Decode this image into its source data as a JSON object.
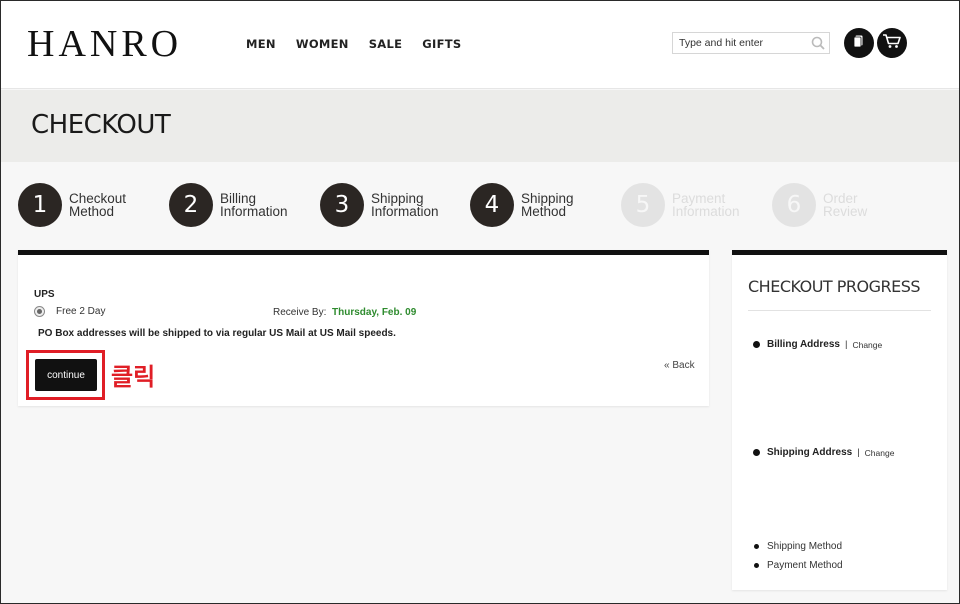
{
  "header": {
    "logo": "HANRO",
    "nav": [
      "MEN",
      "WOMEN",
      "SALE",
      "GIFTS"
    ],
    "search_placeholder": "Type and hit enter",
    "icons": [
      "search-icon",
      "wishlist-icon",
      "cart-icon"
    ]
  },
  "banner": {
    "title": "CHECKOUT"
  },
  "steps": [
    {
      "number": "1",
      "line1": "Checkout",
      "line2": "Method",
      "state": "done"
    },
    {
      "number": "2",
      "line1": "Billing",
      "line2": "Information",
      "state": "done"
    },
    {
      "number": "3",
      "line1": "Shipping",
      "line2": "Information",
      "state": "done"
    },
    {
      "number": "4",
      "line1": "Shipping",
      "line2": "Method",
      "state": "current"
    },
    {
      "number": "5",
      "line1": "Payment",
      "line2": "Information",
      "state": "inactive"
    },
    {
      "number": "6",
      "line1": "Order",
      "line2": "Review",
      "state": "inactive"
    }
  ],
  "shipping": {
    "carrier": "UPS",
    "method": "Free 2 Day",
    "receive_label": "Receive By:",
    "receive_date": "Thursday, Feb. 09",
    "note": "PO Box addresses will be shipped to via regular US Mail at US Mail speeds.",
    "continue_label": "continue",
    "back_label": "« Back"
  },
  "annotation": {
    "click_text": "클릭",
    "color": "#e01e26"
  },
  "progress": {
    "title": "CHECKOUT PROGRESS",
    "items": [
      {
        "label": "Billing Address",
        "separator": "|",
        "change": "Change"
      },
      {
        "label": "Shipping Address",
        "separator": "|",
        "change": "Change"
      },
      {
        "label": "Shipping Method"
      },
      {
        "label": "Payment Method"
      }
    ]
  }
}
